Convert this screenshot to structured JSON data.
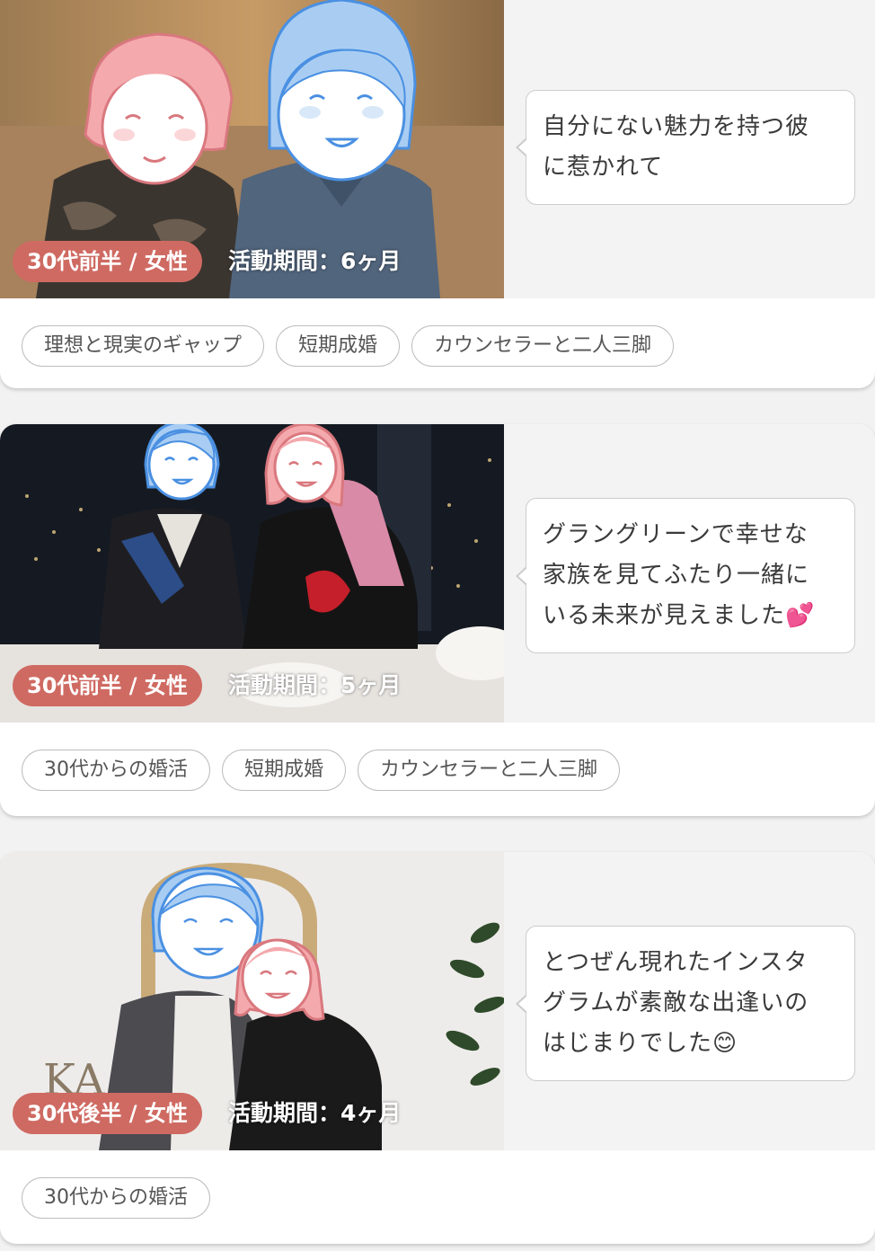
{
  "stories": [
    {
      "age_label": "30代前半 / 女性",
      "duration_label": "活動期間：6ヶ月",
      "message_lines": [
        "自分にない魅力を持つ彼",
        "に惹かれて"
      ],
      "tags": [
        "理想と現実のギャップ",
        "短期成婚",
        "カウンセラーと二人三脚"
      ]
    },
    {
      "age_label": "30代前半 / 女性",
      "duration_label": "活動期間：5ヶ月",
      "message_lines": [
        "グラングリーンで幸せな",
        "家族を見てふたり一緒に",
        "いる未来が見えました💕"
      ],
      "tags": [
        "30代からの婚活",
        "短期成婚",
        "カウンセラーと二人三脚"
      ]
    },
    {
      "age_label": "30代後半 / 女性",
      "duration_label": "活動期間：4ヶ月",
      "message_lines": [
        "とつぜん現れたインスタ",
        "グラムが素敵な出逢いの",
        "はじまりでした😊"
      ],
      "tags": [
        "30代からの婚活"
      ]
    }
  ],
  "colors": {
    "badge": "#cf6a62",
    "face_pink": "#f4a9ad",
    "face_blue": "#a9cdf2"
  }
}
